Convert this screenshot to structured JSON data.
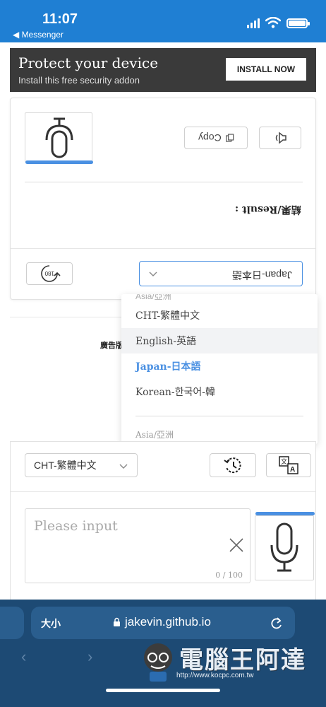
{
  "status_bar": {
    "time": "11:07",
    "back_app": "◀ Messenger"
  },
  "ad_banner": {
    "headline": "Protect your device",
    "subtext": "Install this free security addon",
    "cta": "INSTALL NOW"
  },
  "flipped_panel": {
    "copy_label": "Copy",
    "result_label": "結果/Result :",
    "selected_language": "Japan-日本語",
    "rotate_label": "180"
  },
  "ad_label": "廣告版",
  "language_dropdown": {
    "cut_off_item": "Asia/亞洲",
    "items": [
      {
        "label": "CHT-繁體中文",
        "state": "normal"
      },
      {
        "label": "English-英語",
        "state": "hover"
      },
      {
        "label": "Japan-日本語",
        "state": "selected"
      },
      {
        "label": "Korean-한국어-韓",
        "state": "normal"
      }
    ],
    "group_label": "Asia/亞洲"
  },
  "input_panel": {
    "source_language": "CHT-繁體中文",
    "placeholder": "Please input",
    "counter": "0 / 100"
  },
  "browser": {
    "text_size": "大小",
    "url": "jakevin.github.io"
  },
  "watermark": {
    "brand": "電腦王阿達",
    "site": "http://www.kocpc.com.tw"
  },
  "colors": {
    "status_bar": "#1f7fd3",
    "accent": "#4a90e2",
    "ad_background": "#3a3a3a",
    "browser_bar": "#1d4a74"
  },
  "icons": [
    "signal-icon",
    "wifi-icon",
    "battery-icon",
    "microphone-icon",
    "copy-icon",
    "speaker-icon",
    "rotate-icon",
    "chevron-down-icon",
    "history-icon",
    "translate-icon",
    "close-icon",
    "lock-icon",
    "reload-icon"
  ]
}
